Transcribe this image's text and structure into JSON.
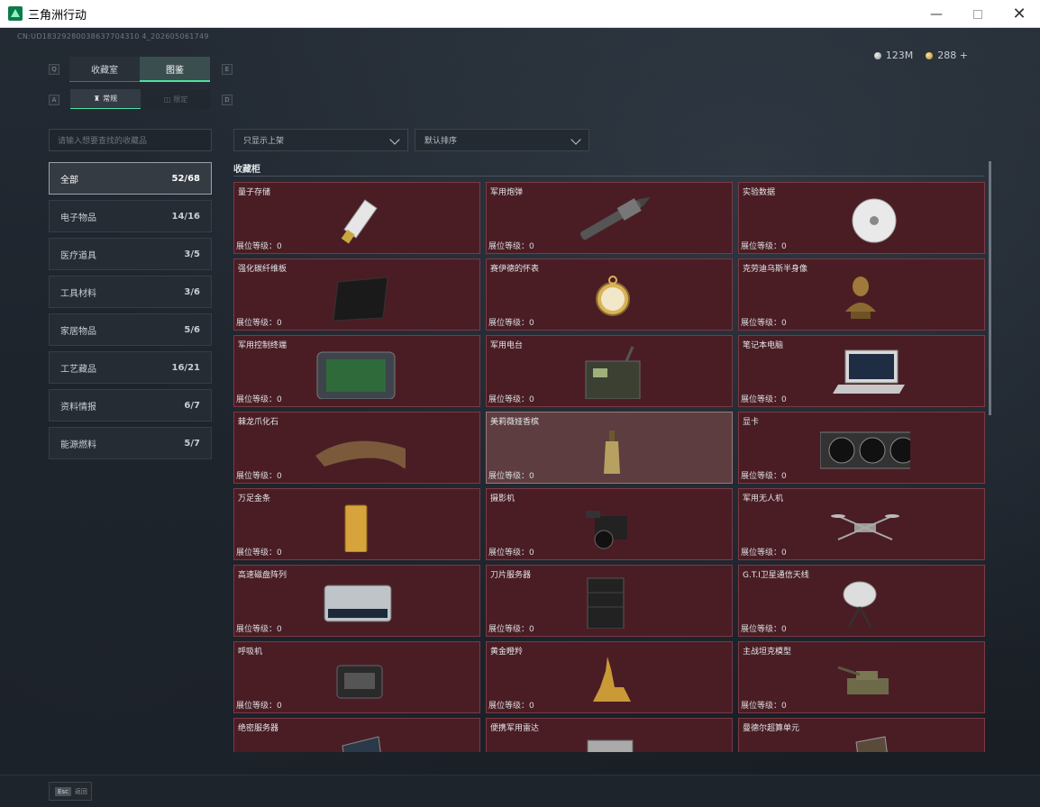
{
  "window": {
    "title": "三角洲行动"
  },
  "uid": "CN:UD18329280038637704310 4_202605061749",
  "currency": [
    {
      "icon": "silver-coin-icon",
      "value": "123M"
    },
    {
      "icon": "gold-coin-icon",
      "value": "288 +"
    }
  ],
  "tabs": {
    "collection_room": "收藏室",
    "catalog": "图鉴",
    "key_left": "Q",
    "key_right": "E"
  },
  "subtabs": {
    "regular": "常规",
    "limited": "限定",
    "key_left": "A",
    "key_right": "D"
  },
  "search": {
    "placeholder": "请输入想要查找的收藏品"
  },
  "filters": {
    "shelf": "只显示上架",
    "sort": "默认排序"
  },
  "categories": [
    {
      "label": "全部",
      "count": "52/68",
      "active": true
    },
    {
      "label": "电子物品",
      "count": "14/16"
    },
    {
      "label": "医疗道具",
      "count": "3/5"
    },
    {
      "label": "工具材料",
      "count": "3/6"
    },
    {
      "label": "家居物品",
      "count": "5/6"
    },
    {
      "label": "工艺藏品",
      "count": "16/21"
    },
    {
      "label": "资料情报",
      "count": "6/7"
    },
    {
      "label": "能源燃料",
      "count": "5/7"
    }
  ],
  "section_title": "收藏柜",
  "level_label": "展位等级：",
  "items": [
    {
      "name": "量子存储",
      "level": "0",
      "icon": "usb-drive-icon"
    },
    {
      "name": "军用炮弹",
      "level": "0",
      "icon": "shell-icon"
    },
    {
      "name": "实验数据",
      "level": "0",
      "icon": "disc-icon"
    },
    {
      "name": "强化碳纤维板",
      "level": "0",
      "icon": "carbon-plate-icon"
    },
    {
      "name": "赛伊德的怀表",
      "level": "0",
      "icon": "pocket-watch-icon"
    },
    {
      "name": "克劳迪乌斯半身像",
      "level": "0",
      "icon": "bust-icon"
    },
    {
      "name": "军用控制终端",
      "level": "0",
      "icon": "terminal-icon"
    },
    {
      "name": "军用电台",
      "level": "0",
      "icon": "radio-icon"
    },
    {
      "name": "笔记本电脑",
      "level": "0",
      "icon": "laptop-icon"
    },
    {
      "name": "棘龙爪化石",
      "level": "0",
      "icon": "claw-fossil-icon"
    },
    {
      "name": "美莉薇娅香槟",
      "level": "0",
      "icon": "champagne-icon",
      "hover": true
    },
    {
      "name": "显卡",
      "level": "0",
      "icon": "gpu-icon"
    },
    {
      "name": "万足金条",
      "level": "0",
      "icon": "gold-bar-icon"
    },
    {
      "name": "摄影机",
      "level": "0",
      "icon": "camera-icon"
    },
    {
      "name": "军用无人机",
      "level": "0",
      "icon": "drone-icon"
    },
    {
      "name": "高速磁盘阵列",
      "level": "0",
      "icon": "disk-array-icon"
    },
    {
      "name": "刀片服务器",
      "level": "0",
      "icon": "blade-server-icon"
    },
    {
      "name": "G.T.I卫星通信天线",
      "level": "0",
      "icon": "satellite-dish-icon"
    },
    {
      "name": "呼吸机",
      "level": "0",
      "icon": "ventilator-icon"
    },
    {
      "name": "黄金瞪羚",
      "level": "0",
      "icon": "gold-gazelle-icon"
    },
    {
      "name": "主战坦克模型",
      "level": "0",
      "icon": "tank-model-icon"
    },
    {
      "name": "绝密服务器",
      "level": "",
      "icon": "secret-server-icon"
    },
    {
      "name": "便携军用雷达",
      "level": "",
      "icon": "radar-icon"
    },
    {
      "name": "曼德尔超算单元",
      "level": "",
      "icon": "supercomputer-icon"
    }
  ],
  "esc": {
    "key": "Esc",
    "label": "返回"
  },
  "colors": {
    "accent": "#4fe0a0",
    "card_bg": "#4a1d25",
    "card_border": "#7a3a44"
  }
}
